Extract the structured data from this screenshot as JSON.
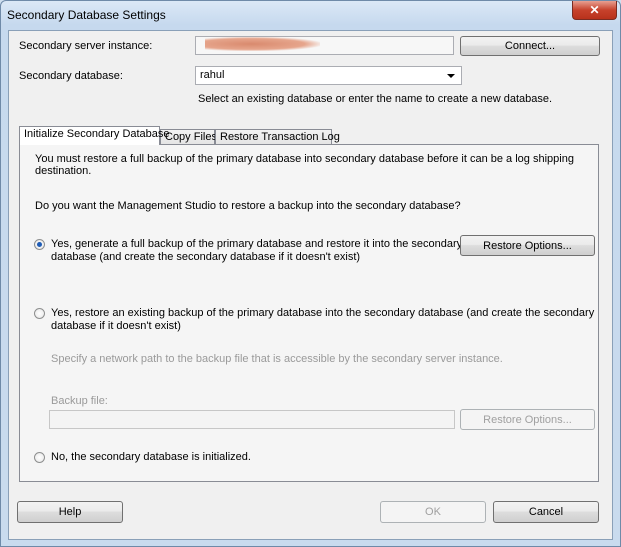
{
  "window": {
    "title": "Secondary Database Settings",
    "close_glyph": "✕"
  },
  "server": {
    "label": "Secondary server instance:",
    "connect_label": "Connect..."
  },
  "database": {
    "label": "Secondary database:",
    "value": "rahul",
    "hint": "Select an existing database or enter the name to create a new database."
  },
  "tabs": [
    {
      "label": "Initialize Secondary Database"
    },
    {
      "label": "Copy Files"
    },
    {
      "label": "Restore Transaction Log"
    }
  ],
  "init": {
    "intro": "You must restore a full backup of the primary database into secondary database before it can be a log shipping destination.",
    "question": "Do you want the Management Studio to restore a backup into the secondary database?",
    "option1_line1": "Yes, generate a full backup of the primary database and restore it into the secondary",
    "option1_line2": "database (and create the secondary database if it doesn't exist)",
    "restore_options_label": "Restore Options...",
    "option2_line1": "Yes, restore an existing backup of the primary database into the secondary database (and create the secondary",
    "option2_line2": "database if it doesn't exist)",
    "network_path_hint": "Specify a network path to the backup file that is accessible by the secondary server instance.",
    "backup_file_label": "Backup file:",
    "restore_options2_label": "Restore Options...",
    "option3": "No, the secondary database is initialized."
  },
  "footer": {
    "help": "Help",
    "ok": "OK",
    "cancel": "Cancel"
  }
}
